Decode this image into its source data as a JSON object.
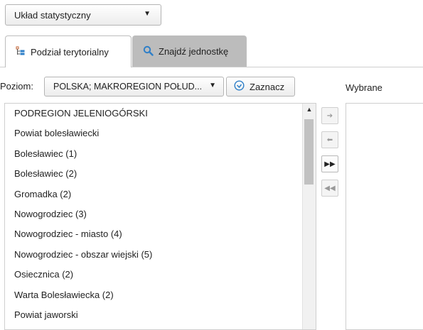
{
  "layout_select": {
    "value": "Układ statystyczny",
    "caret": "▼"
  },
  "tabs": [
    {
      "label": "Podział terytorialny",
      "icon": "tree-icon",
      "active": true
    },
    {
      "label": "Znajdź jednostkę",
      "icon": "search-icon",
      "active": false
    }
  ],
  "level": {
    "label": "Poziom:",
    "value": "POLSKA; MAKROREGION POŁUD...",
    "caret": "▼"
  },
  "mark_button": {
    "label": "Zaznacz",
    "icon": "check-circle-icon"
  },
  "selected_panel": {
    "label": "Wybrane"
  },
  "units": [
    "PODREGION JELENIOGÓRSKI",
    "Powiat bolesławiecki",
    "Bolesławiec (1)",
    "Bolesławiec (2)",
    "Gromadka (2)",
    "Nowogrodziec (3)",
    "Nowogrodziec - miasto (4)",
    "Nowogrodziec - obszar wiejski (5)",
    "Osiecznica (2)",
    "Warta Bolesławiecka (2)",
    "Powiat jaworski"
  ],
  "move_buttons": [
    {
      "name": "move-right",
      "glyph": "➔",
      "active": false
    },
    {
      "name": "move-left",
      "glyph": "⬅",
      "active": false
    },
    {
      "name": "move-all-right",
      "glyph": "▶▶",
      "active": true
    },
    {
      "name": "move-all-left",
      "glyph": "◀◀",
      "active": false
    }
  ],
  "colors": {
    "accent": "#2e7fc8",
    "tab_inactive": "#bcbcbc",
    "icon_tree": "#c06030"
  }
}
